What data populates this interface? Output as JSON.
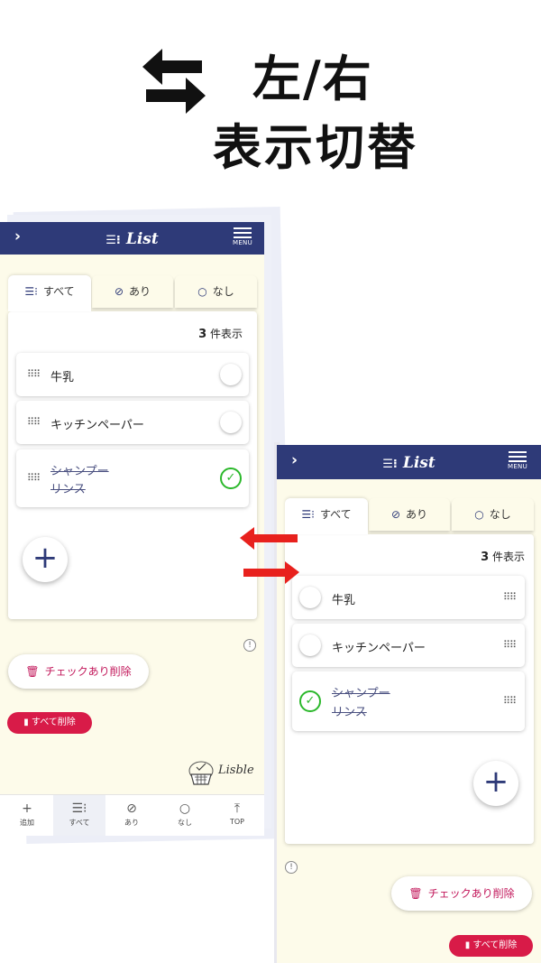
{
  "caption": {
    "line1": "左/右",
    "line2": "表示切替"
  },
  "colors": {
    "navy": "#2e3a78",
    "cream": "#fdfbea",
    "check_green": "#2bb82b",
    "delete_red": "#d81b48",
    "accent_pink": "#c2185b",
    "arrow_red": "#e8211d"
  },
  "screens": {
    "left": {
      "header": {
        "title": "List",
        "menu_label": "MENU"
      },
      "tabs": [
        {
          "label": "すべて",
          "icon": "list-icon"
        },
        {
          "label": "あり",
          "icon": "check-circle-icon"
        },
        {
          "label": "なし",
          "icon": "circle-icon"
        }
      ],
      "count": {
        "number": "3",
        "suffix": "件表示"
      },
      "items": [
        {
          "label": "牛乳",
          "checked": false
        },
        {
          "label": "キッチンペーパー",
          "checked": false
        },
        {
          "label_line1": "シャンプー",
          "label_line2": "リンス",
          "checked": true
        }
      ],
      "info_icon": "!",
      "delete_checked_label": "チェックあり削除",
      "delete_all_label": "すべて削除",
      "logo_text": "Lisble",
      "nav": [
        {
          "icon": "plus-icon",
          "label": "追加"
        },
        {
          "icon": "list-icon",
          "label": "すべて"
        },
        {
          "icon": "check-circle-icon",
          "label": "あり"
        },
        {
          "icon": "circle-icon",
          "label": "なし"
        },
        {
          "icon": "top-arrow-icon",
          "label": "TOP"
        }
      ]
    },
    "right": {
      "header": {
        "title": "List",
        "menu_label": "MENU"
      },
      "tabs": [
        {
          "label": "すべて"
        },
        {
          "label": "あり"
        },
        {
          "label": "なし"
        }
      ],
      "count": {
        "number": "3",
        "suffix": "件表示"
      },
      "items": [
        {
          "label": "牛乳",
          "checked": false
        },
        {
          "label": "キッチンペーパー",
          "checked": false
        },
        {
          "label_line1": "シャンプー",
          "label_line2": "リンス",
          "checked": true
        }
      ],
      "info_icon": "!",
      "delete_checked_label": "チェックあり削除",
      "delete_all_label": "すべて削除"
    }
  }
}
